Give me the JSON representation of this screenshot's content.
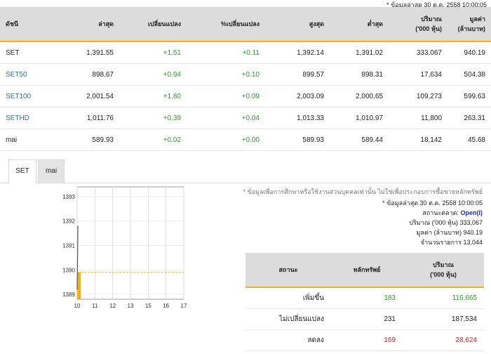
{
  "top_note": "* ข้อมูลล่าสุด 30 ต.ค. 2558 10:00:05",
  "index_table": {
    "headers": {
      "name": "ดัชนี",
      "last": "ล่าสุด",
      "change": "เปลี่ยนแปลง",
      "pct_change": "%เปลี่ยนแปลง",
      "high": "สูงสุด",
      "low": "ต่ำสุด",
      "volume_l1": "ปริมาณ",
      "volume_l2": "('000 หุ้น)",
      "value_l1": "มูลค่า",
      "value_l2": "(ล้านบาท)"
    },
    "rows": [
      {
        "name": "SET",
        "last": "1,391.55",
        "change": "+1.51",
        "pct_change": "+0.11",
        "high": "1,392.14",
        "low": "1,391.02",
        "volume": "333,067",
        "value": "940.19"
      },
      {
        "name": "SET50",
        "last": "898.67",
        "change": "+0.94",
        "pct_change": "+0.10",
        "high": "899.57",
        "low": "898.31",
        "volume": "17,634",
        "value": "504.38"
      },
      {
        "name": "SET100",
        "last": "2,001.54",
        "change": "+1.80",
        "pct_change": "+0.09",
        "high": "2,003.09",
        "low": "2,000.65",
        "volume": "109,273",
        "value": "599.63"
      },
      {
        "name": "SETHD",
        "last": "1,011.76",
        "change": "+0.39",
        "pct_change": "+0.04",
        "high": "1,013.33",
        "low": "1,010.97",
        "volume": "11,800",
        "value": "263.31"
      },
      {
        "name": "mai",
        "last": "589.93",
        "change": "+0.02",
        "pct_change": "+0.00",
        "high": "589.93",
        "low": "589.44",
        "volume": "18,142",
        "value": "45.68"
      }
    ]
  },
  "tabs": {
    "set": "SET",
    "mai": "mai"
  },
  "disclaimer": "* ข้อมูลเพื่อการศึกษาหรือใช้งานส่วนบุคคลเท่านั้น ไม่ใช่เพื่อประกอบการซื้อขายหลักทรัพย์",
  "info": {
    "latest": "* ข้อมูลล่าสุด 30 ต.ค. 2558 10:00:05",
    "market_status_label": "สถานะตลาด:",
    "market_status": "Open(I)",
    "volume_label": "ปริมาณ ('000 หุ้น)",
    "volume": "333,067",
    "value_label": "มูลค่า (ล้านบาท)",
    "value": "940.19",
    "trades_label": "จำนวนรายการ",
    "trades": "13,044"
  },
  "stat_table": {
    "headers": {
      "status": "สถานะ",
      "securities": "หลักทรัพย์",
      "volume_l1": "ปริมาณ",
      "volume_l2": "('000 หุ้น)"
    },
    "rows": [
      {
        "status": "เพิ่มขึ้น",
        "securities": "183",
        "volume": "116,665",
        "color": "green"
      },
      {
        "status": "ไม่เปลี่ยนแปลง",
        "securities": "231",
        "volume": "187,534",
        "color": "none"
      },
      {
        "status": "ลดลง",
        "securities": "169",
        "volume": "28,624",
        "color": "red"
      }
    ]
  },
  "colors": {
    "accent": "#f2b01e",
    "up": "#2a9d2a",
    "down": "#d0202a",
    "link": "#2f6eb5",
    "open": "#1b2fb5"
  },
  "chart_data": {
    "type": "line",
    "x_ticks": [
      "10",
      "11",
      "12",
      "13",
      "15",
      "16",
      "17"
    ],
    "y_ticks": [
      "1393",
      "1392",
      "1391",
      "1390",
      "1389"
    ],
    "ylim": [
      1388.8,
      1393.4
    ],
    "xlim": [
      10,
      17
    ],
    "reference_line": 1389.9,
    "line_x": [
      10.0,
      10.05
    ],
    "line_y": [
      1389.2,
      1391.8
    ],
    "bar_top": 1389.9,
    "grid": true
  }
}
